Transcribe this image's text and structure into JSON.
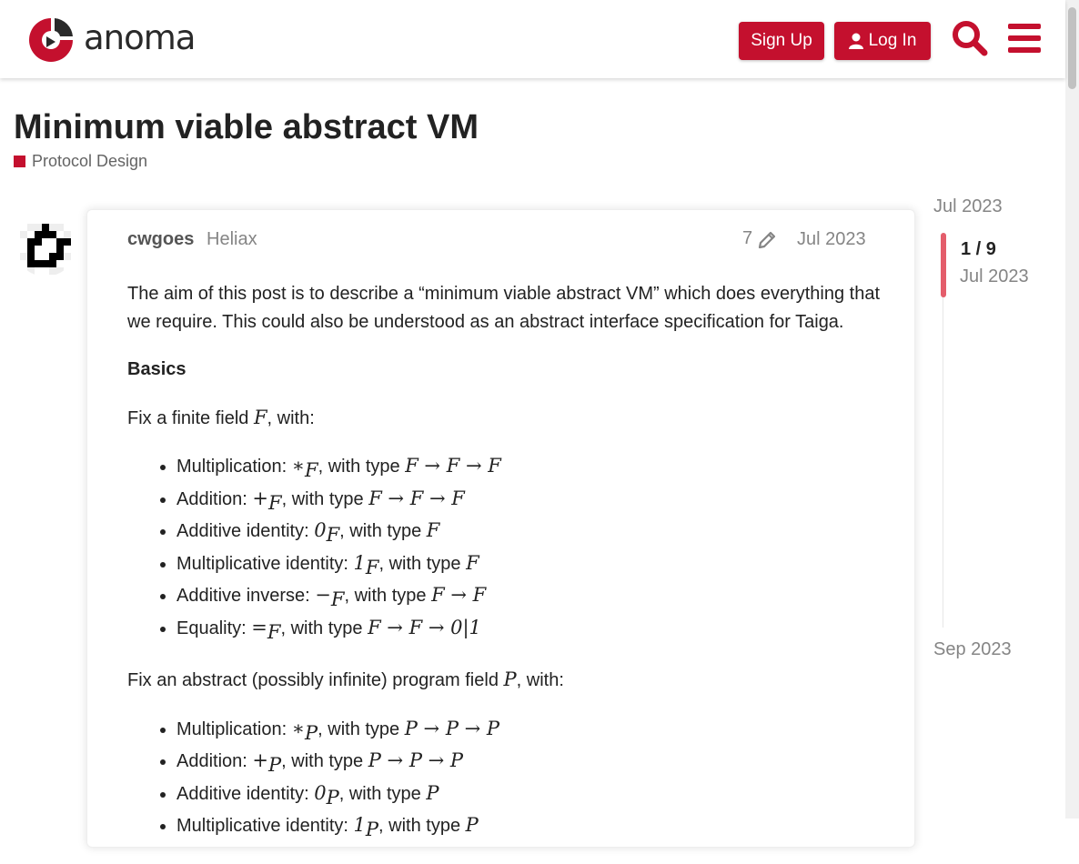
{
  "header": {
    "logo_text": "anoma",
    "signup_label": "Sign Up",
    "login_label": "Log In",
    "accent_color": "#c4102e"
  },
  "topic": {
    "title": "Minimum viable abstract VM",
    "category": "Protocol Design"
  },
  "post": {
    "username": "cwgoes",
    "user_title": "Heliax",
    "edit_count": "7",
    "date": "Jul 2023",
    "intro": "The aim of this post is to describe a “minimum viable abstract VM” which does everything that we require. This could also be understood as an abstract interface specification for Taiga.",
    "section_heading": "Basics",
    "finite_field": {
      "intro_prefix": "Fix a finite field ",
      "symbol": "F",
      "intro_suffix": ", with:",
      "items": [
        {
          "label": "Multiplication: ",
          "op": "∗",
          "sub": "F",
          "type_prefix": ", with type ",
          "type": "F → F → F"
        },
        {
          "label": "Addition: ",
          "op": "+",
          "sub": "F",
          "type_prefix": ", with type ",
          "type": "F → F → F"
        },
        {
          "label": "Additive identity: ",
          "op": "0",
          "sub": "F",
          "type_prefix": ", with type ",
          "type": "F"
        },
        {
          "label": "Multiplicative identity: ",
          "op": "1",
          "sub": "F",
          "type_prefix": ", with type ",
          "type": "F"
        },
        {
          "label": "Additive inverse: ",
          "op": "−",
          "sub": "F",
          "type_prefix": ", with type ",
          "type": "F → F"
        },
        {
          "label": "Equality: ",
          "op": "=",
          "sub": "F",
          "type_prefix": ", with type ",
          "type": "F → F → 0|1"
        }
      ]
    },
    "program_field": {
      "intro_prefix": "Fix an abstract (possibly infinite) program field ",
      "symbol": "P",
      "intro_suffix": ", with:",
      "items": [
        {
          "label": "Multiplication: ",
          "op": "∗",
          "sub": "P",
          "type_prefix": ", with type ",
          "type": "P → P → P"
        },
        {
          "label": "Addition: ",
          "op": "+",
          "sub": "P",
          "type_prefix": ", with type ",
          "type": "P → P → P"
        },
        {
          "label": "Additive identity: ",
          "op": "0",
          "sub": "P",
          "type_prefix": ", with type ",
          "type": "P"
        },
        {
          "label": "Multiplicative identity: ",
          "op": "1",
          "sub": "P",
          "type_prefix": ", with type ",
          "type": "P"
        }
      ]
    }
  },
  "timeline": {
    "start_date": "Jul 2023",
    "position": "1 / 9",
    "position_date": "Jul 2023",
    "end_date": "Sep 2023",
    "position_fraction": 0.11
  }
}
